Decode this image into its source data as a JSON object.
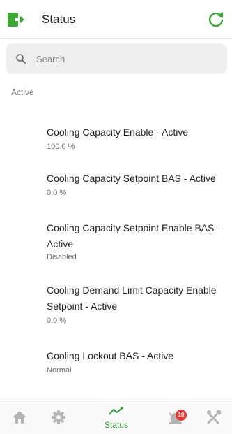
{
  "header": {
    "title": "Status",
    "exit_icon": "exit-to-app-icon",
    "refresh_icon": "refresh-icon",
    "accent_color": "#3aaa35"
  },
  "search": {
    "placeholder": "Search",
    "value": ""
  },
  "section": {
    "label": "Active"
  },
  "items": [
    {
      "name": "Cooling Capacity Enable - Active",
      "value": "100.0 %"
    },
    {
      "name": "Cooling Capacity Setpoint BAS - Active",
      "value": "0.0 %"
    },
    {
      "name": "Cooling Capacity Setpoint Enable BAS - Active",
      "value": "Disabled"
    },
    {
      "name": "Cooling Demand Limit Capacity Enable Setpoint - Active",
      "value": "0.0 %"
    },
    {
      "name": "Cooling Lockout BAS - Active",
      "value": "Normal"
    }
  ],
  "bottom_nav": {
    "items": [
      {
        "icon": "home-icon"
      },
      {
        "icon": "gear-icon"
      },
      {
        "icon": "trend-icon",
        "label": "Status",
        "active": true
      },
      {
        "icon": "alarm-icon",
        "badge": "10"
      },
      {
        "icon": "tools-icon"
      }
    ],
    "active_color": "#2e9e3a",
    "inactive_color": "#b5b5b5",
    "badge_color": "#e53935"
  }
}
